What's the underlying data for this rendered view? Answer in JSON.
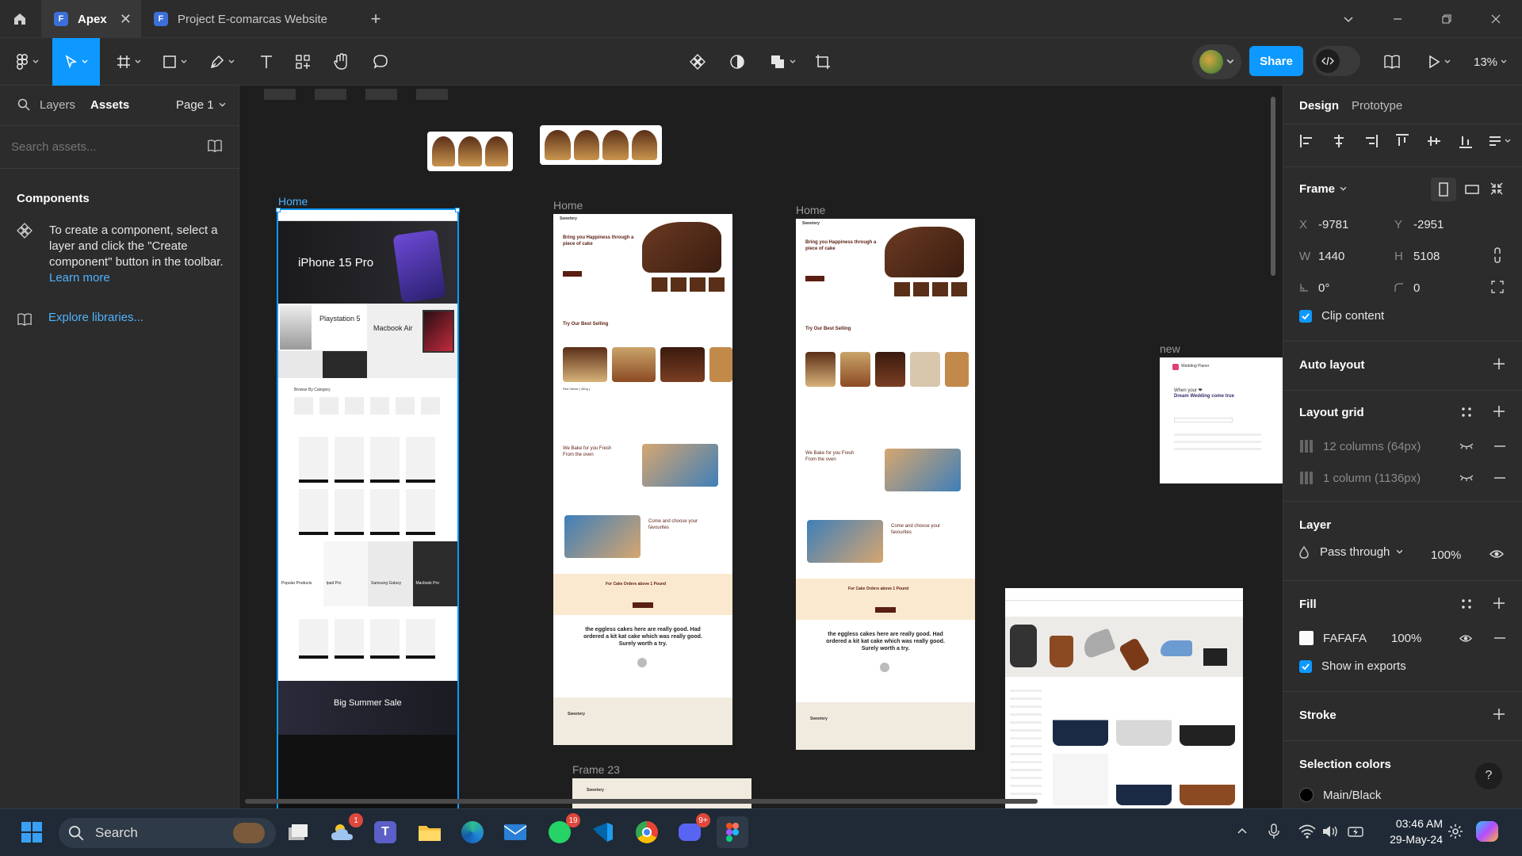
{
  "window": {
    "tabs": [
      {
        "label": "Apex",
        "active": true
      },
      {
        "label": "Project E-comarcas Website",
        "active": false
      }
    ]
  },
  "toolbar": {
    "share_label": "Share",
    "zoom": "13%"
  },
  "left_panel": {
    "tabs": [
      "Layers",
      "Assets"
    ],
    "page_selector": "Page 1",
    "search_placeholder": "Search assets...",
    "components_heading": "Components",
    "components_help": "To create a component, select a layer and click the \"Create component\" button in the toolbar.",
    "learn_more": "Learn more",
    "explore_libraries": "Explore libraries..."
  },
  "canvas": {
    "frame_labels": {
      "home1": "Home",
      "home2": "Home",
      "home3": "Home",
      "new": "new",
      "frame23": "Frame 23"
    },
    "apple_frame": {
      "hero": "iPhone 15 Pro",
      "playstation": "Playstation 5",
      "macbook": "Macbook Air",
      "summer_sale": "Big Summer Sale",
      "popular": "Popular Products",
      "ipad": "Ipad Pro",
      "galaxy": "Samsung Galaxy",
      "macbook_pro": "Macbook Pro",
      "category_heading": "Browse By Category"
    },
    "cake_frame": {
      "brand": "Sweetery",
      "hero_title": "Bring you Happiness through a piece of cake",
      "best_selling": "Try Our Best Selling",
      "bake_heading": "We Bake for you Fresh From the oven",
      "choose_heading": "Come and choose your favourites",
      "orders_banner": "For Cake Orders above 1 Pound",
      "testimonial": "the eggless cakes here are really good. Had ordered a kit kat cake which was really good. Surely worth a try.",
      "product_name": "Red Velvet ( 450g )"
    },
    "wedding_frame": {
      "brand": "Wedding Planer",
      "headline_1": "When your ❤",
      "headline_2": "Dream Wedding come true"
    }
  },
  "right_panel": {
    "tabs": [
      "Design",
      "Prototype"
    ],
    "frame_label": "Frame",
    "x": {
      "label": "X",
      "value": "-9781"
    },
    "y": {
      "label": "Y",
      "value": "-2951"
    },
    "w": {
      "label": "W",
      "value": "1440"
    },
    "h": {
      "label": "H",
      "value": "5108"
    },
    "rotation": "0°",
    "radius": "0",
    "clip_content": "Clip content",
    "auto_layout": "Auto layout",
    "layout_grid": "Layout grid",
    "grids": [
      "12 columns (64px)",
      "1 column (1136px)"
    ],
    "layer": "Layer",
    "blend_mode": "Pass through",
    "layer_opacity": "100%",
    "fill": "Fill",
    "fill_hex": "FAFAFA",
    "fill_opacity": "100%",
    "show_in_exports": "Show in exports",
    "stroke": "Stroke",
    "selection_colors": "Selection colors",
    "selection_color_name": "Main/Black",
    "help": "?"
  },
  "taskbar": {
    "search_label": "Search",
    "time": "03:46 AM",
    "date": "29-May-24",
    "badges": {
      "weather": "1",
      "whatsapp": "19",
      "discord": "9+"
    }
  },
  "colors": {
    "accent": "#0d99ff",
    "panel": "#2c2c2c",
    "canvas": "#1e1e1e",
    "fill_swatch": "#FAFAFA",
    "cake_brown": "#4a2616"
  }
}
